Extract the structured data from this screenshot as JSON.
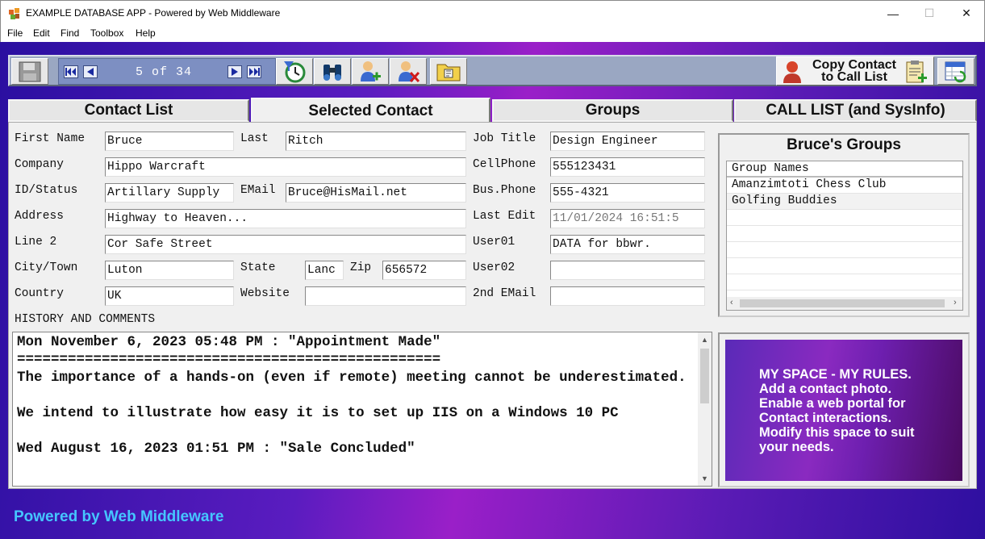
{
  "window": {
    "title": "EXAMPLE DATABASE APP - Powered by Web Middleware",
    "minimize": "—",
    "maximize": "☐",
    "close": "✕"
  },
  "menu": {
    "items": [
      "File",
      "Edit",
      "Find",
      "Toolbox",
      "Help"
    ]
  },
  "toolbar": {
    "record_position": "5 of 34",
    "copy_line1": "Copy Contact",
    "copy_line2": "to Call List",
    "icons": [
      "save-icon",
      "first-record-icon",
      "previous-record-icon",
      "next-record-icon",
      "last-record-icon",
      "filter-clock-icon",
      "binoculars-icon",
      "add-contact-icon",
      "delete-contact-icon",
      "folder-icon",
      "clipboard-add-icon",
      "refresh-table-icon"
    ]
  },
  "tabs": [
    "Contact List",
    "Selected Contact",
    "Groups",
    "CALL LIST (and SysInfo)"
  ],
  "form": {
    "labels": {
      "first_name": "First Name",
      "last": "Last",
      "job_title": "Job Title",
      "company": "Company",
      "cellphone": "CellPhone",
      "id_status": "ID/Status",
      "email": "EMail",
      "bus_phone": "Bus.Phone",
      "address": "Address",
      "last_edit": "Last Edit",
      "line2": "Line 2",
      "user01": "User01",
      "city": "City/Town",
      "state": "State",
      "zip": "Zip",
      "user02": "User02",
      "country": "Country",
      "website": "Website",
      "email2": "2nd EMail",
      "history": "HISTORY AND COMMENTS"
    },
    "values": {
      "first_name": "Bruce",
      "last": "Ritch",
      "job_title": "Design Engineer",
      "company": "Hippo Warcraft",
      "cellphone": "555123431",
      "id_status": "Artillary Supply",
      "email": "Bruce@HisMail.net",
      "bus_phone": "555-4321",
      "address": "Highway to Heaven...",
      "last_edit": "11/01/2024 16:51:5",
      "line2": "Cor Safe Street",
      "user01": "DATA for bbwr.",
      "city": "Luton",
      "state": "Lanc",
      "zip": "656572",
      "user02": "",
      "country": "UK",
      "website": "",
      "email2": ""
    }
  },
  "history": {
    "text": "Mon November 6, 2023 05:48 PM : \"Appointment Made\"\n==================================================\nThe importance of a hands-on (even if remote) meeting cannot be underestimated.\n\nWe intend to illustrate how easy it is to set up IIS on a Windows 10 PC\n\nWed August 16, 2023 01:51 PM : \"Sale Concluded\""
  },
  "groups": {
    "title": "Bruce's Groups",
    "header": "Group Names",
    "rows": [
      "Amanzimtoti Chess Club",
      "Golfing Buddies"
    ]
  },
  "myspace": {
    "lines": [
      "MY SPACE - MY RULES.",
      "Add a contact photo.",
      "Enable a web portal for",
      "Contact interactions.",
      "Modify this space to suit",
      "your needs."
    ]
  },
  "footer": {
    "text": "Powered by Web Middleware"
  },
  "colors": {
    "toolbar": "#9aa7c2",
    "footer_text": "#45c6ff",
    "background_left": "#2a0fa0",
    "background_mid": "#9a1fc8"
  }
}
